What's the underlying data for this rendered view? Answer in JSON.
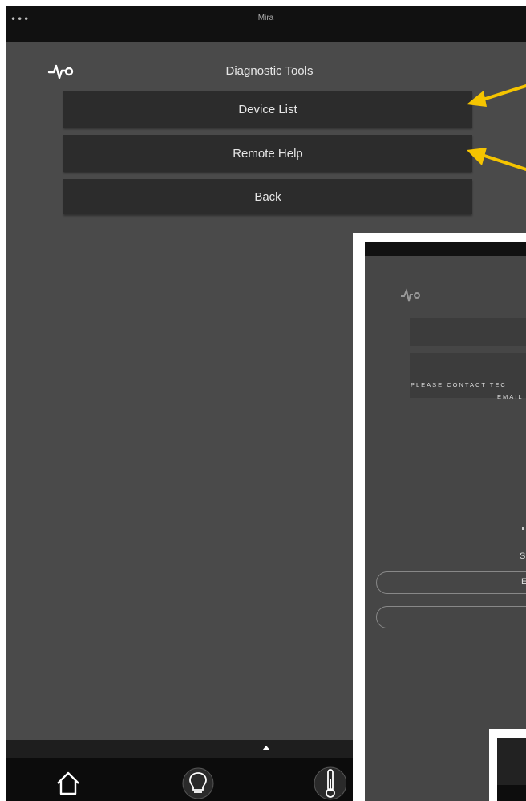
{
  "status_bar": {
    "dots": "•••",
    "title": "Mira"
  },
  "header": {
    "title": "Diagnostic Tools",
    "icon": "pulse-icon"
  },
  "menu": [
    {
      "label": "Device List"
    },
    {
      "label": "Remote Help"
    },
    {
      "label": "Back"
    }
  ],
  "tab_bar": {
    "icons": [
      "home-icon",
      "bulb-icon",
      "thermometer-icon"
    ]
  },
  "inset": {
    "message_line1": "PLEASE CONTACT TEC",
    "message_line2": "EMAIL",
    "letter_s": "S",
    "pill_label": "EN"
  },
  "colors": {
    "background": "#4a4a4a",
    "button": "#2c2c2c",
    "arrow": "#f5c400",
    "bar": "#111111"
  }
}
